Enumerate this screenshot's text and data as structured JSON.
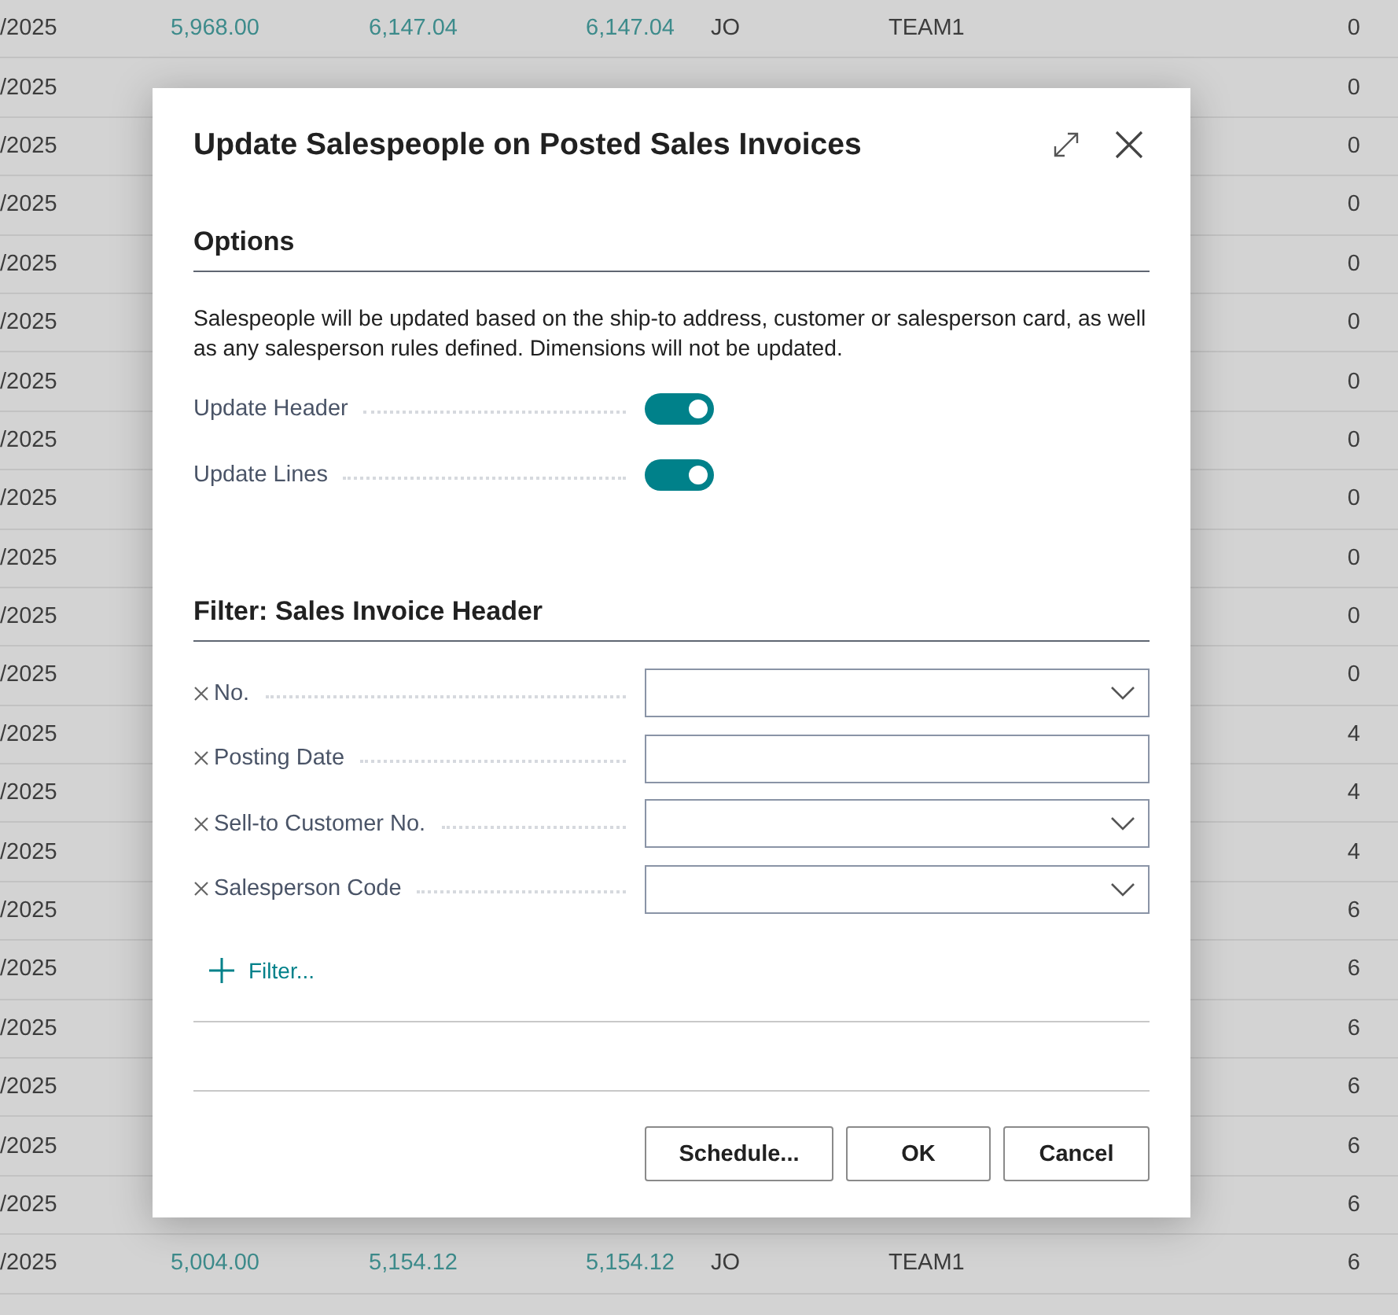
{
  "background_table": {
    "rows": [
      {
        "column_1": "/2025",
        "column_2": "5,968.00",
        "column_3": "6,147.04",
        "column_4": "6,147.04",
        "column_5": "JO",
        "column_6": "TEAM1",
        "column_7": "0"
      },
      {
        "column_1": "/2025",
        "column_7": "0"
      },
      {
        "column_1": "/2025",
        "column_7": "0"
      },
      {
        "column_1": "/2025",
        "column_7": "0"
      },
      {
        "column_1": "/2025",
        "column_7": "0"
      },
      {
        "column_1": "/2025",
        "column_7": "0"
      },
      {
        "column_1": "/2025",
        "column_7": "0"
      },
      {
        "column_1": "/2025",
        "column_7": "0"
      },
      {
        "column_1": "/2025",
        "column_7": "0"
      },
      {
        "column_1": "/2025",
        "column_7": "0"
      },
      {
        "column_1": "/2025",
        "column_7": "0"
      },
      {
        "column_1": "/2025",
        "column_7": "0"
      },
      {
        "column_1": "/2025",
        "column_7": "4"
      },
      {
        "column_1": "/2025",
        "column_7": "4"
      },
      {
        "column_1": "/2025",
        "column_7": "4"
      },
      {
        "column_1": "/2025",
        "column_7": "6"
      },
      {
        "column_1": "/2025",
        "column_7": "6"
      },
      {
        "column_1": "/2025",
        "column_7": "6"
      },
      {
        "column_1": "/2025",
        "column_7": "6"
      },
      {
        "column_1": "/2025",
        "column_7": "6"
      },
      {
        "column_1": "/2025",
        "column_7": "6"
      },
      {
        "column_1": "/2025",
        "column_2": "5,004.00",
        "column_3": "5,154.12",
        "column_4": "5,154.12",
        "column_5": "JO",
        "column_6": "TEAM1",
        "column_7": "6"
      }
    ]
  },
  "dialog": {
    "title": "Update Salespeople on Posted Sales Invoices",
    "options": {
      "heading": "Options",
      "description": "Salespeople will be updated based on the ship-to address, customer or salesperson card, as well as any salesperson rules defined. Dimensions will not be updated.",
      "toggles": [
        {
          "label": "Update Header",
          "on": true
        },
        {
          "label": "Update Lines",
          "on": true
        }
      ]
    },
    "filter": {
      "heading": "Filter: Sales Invoice Header",
      "fields": [
        {
          "label": "No.",
          "kind": "dropdown"
        },
        {
          "label": "Posting Date",
          "kind": "text"
        },
        {
          "label": "Sell-to Customer No.",
          "kind": "dropdown"
        },
        {
          "label": "Salesperson Code",
          "kind": "dropdown"
        }
      ],
      "add_filter": "Filter..."
    },
    "buttons": [
      "Schedule...",
      "OK",
      "Cancel"
    ]
  }
}
